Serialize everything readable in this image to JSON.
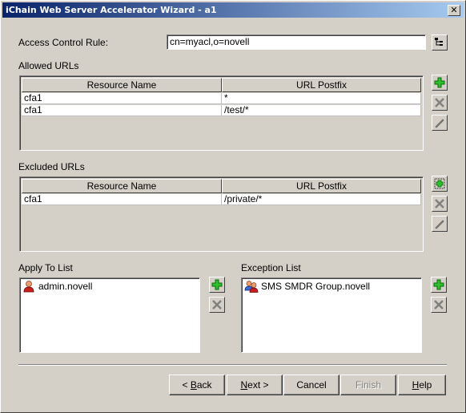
{
  "window": {
    "title": "iChain Web Server Accelerator Wizard - a1",
    "close_glyph": "✕"
  },
  "access_control": {
    "label": "Access Control Rule:",
    "value": "cn=myacl,o=novell"
  },
  "allowed": {
    "label": "Allowed URLs",
    "columns": [
      "Resource Name",
      "URL Postfix"
    ],
    "rows": [
      {
        "resource": "cfa1",
        "postfix": "*"
      },
      {
        "resource": "cfa1",
        "postfix": "/test/*"
      }
    ]
  },
  "excluded": {
    "label": "Excluded URLs",
    "columns": [
      "Resource Name",
      "URL Postfix"
    ],
    "rows": [
      {
        "resource": "cfa1",
        "postfix": "/private/*"
      }
    ]
  },
  "apply_to": {
    "label": "Apply To List",
    "items": [
      {
        "name": "admin.novell",
        "icon": "user-icon"
      }
    ]
  },
  "exception": {
    "label": "Exception List",
    "items": [
      {
        "name": "SMS SMDR Group.novell",
        "icon": "group-icon"
      }
    ]
  },
  "buttons": {
    "back": {
      "prefix": "< ",
      "hotkey": "B",
      "rest": "ack"
    },
    "next": {
      "hotkey": "N",
      "rest": "ext >"
    },
    "cancel": "Cancel",
    "finish": "Finish",
    "help": {
      "hotkey": "H",
      "rest": "elp"
    }
  },
  "colors": {
    "title_start": "#0a246a",
    "title_end": "#a6caf0",
    "face": "#d4d0c8",
    "add_green": "#1a8a1a",
    "delete_gray": "#808080"
  }
}
